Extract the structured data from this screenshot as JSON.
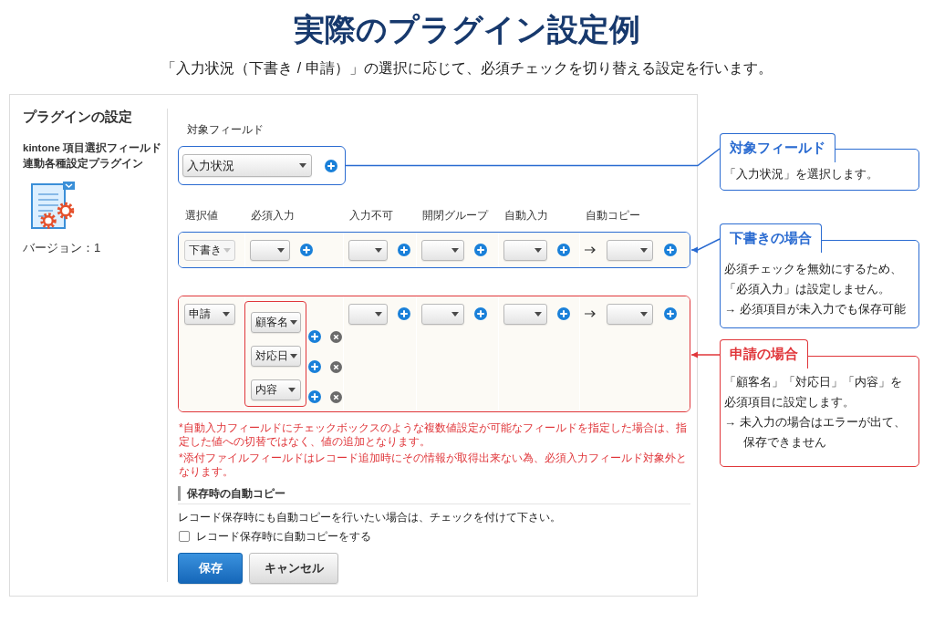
{
  "title": "実際のプラグイン設定例",
  "subtitle": "「入力状況（下書き / 申請）」の選択に応じて、必須チェックを切り替える設定を行います。",
  "plugin_settings": {
    "sidebar": {
      "heading": "プラグインの設定",
      "plugin_name": [
        "kintone 項目選択フィールド",
        "連動各種設定プラグイン"
      ],
      "version": "バージョン：1"
    },
    "target_field": {
      "label": "対象フィールド",
      "value": "入力状況"
    },
    "columns": [
      {
        "label": "選択値",
        "kind": "value"
      },
      {
        "label": "必須入力",
        "kind": "multi"
      },
      {
        "label": "入力不可",
        "kind": "single"
      },
      {
        "label": "開閉グループ",
        "kind": "single"
      },
      {
        "label": "自動入力",
        "kind": "single"
      },
      {
        "label": "自動コピー",
        "kind": "copy"
      }
    ],
    "rows": [
      {
        "color": "#2a6bd1",
        "value": "下書き",
        "value_disabled": true,
        "required_outlined": false,
        "required": [
          {
            "removable": false
          }
        ]
      },
      {
        "color": "#e0363a",
        "value": "申請",
        "value_disabled": false,
        "required_outlined": true,
        "required": [
          {
            "value": "顧客名",
            "removable": true
          },
          {
            "value": "対応日",
            "removable": true
          },
          {
            "value": "内容",
            "removable": true
          }
        ]
      }
    ],
    "notes": [
      "*自動入力フィールドにチェックボックスのような複数値設定が可能なフィールドを指定した場合は、指定した値への切替ではなく、値の追加となります。",
      "*添付ファイルフィールドはレコード追加時にその情報が取得出来ない為、必須入力フィールド対象外となります。"
    ],
    "auto_copy": {
      "heading": "保存時の自動コピー",
      "description": "レコード保存時にも自動コピーを行いたい場合は、チェックを付けて下さい。",
      "checkbox": {
        "label": "レコード保存時に自動コピーをする",
        "checked": false
      }
    },
    "buttons": [
      {
        "label": "保存",
        "kind": "primary"
      },
      {
        "label": "キャンセル",
        "kind": "secondary"
      }
    ]
  },
  "callouts": [
    {
      "title": "対象フィールド",
      "color": "#2a6bd1",
      "arrowhead": false,
      "paragraphs": [
        {
          "kind": "plain",
          "lines": [
            "「入力状況」を選択します。"
          ]
        }
      ]
    },
    {
      "title": "下書きの場合",
      "color": "#2a6bd1",
      "arrowhead": true,
      "paragraphs": [
        {
          "kind": "plain",
          "lines": [
            "必須チェックを無効にするため、",
            "「必須入力」は設定しません。"
          ]
        },
        {
          "kind": "arrow",
          "lines": [
            "→ 必須項目が未入力でも保存可能"
          ]
        }
      ]
    },
    {
      "title": "申請の場合",
      "color": "#e0363a",
      "arrowhead": true,
      "paragraphs": [
        {
          "kind": "plain",
          "lines": [
            "「顧客名」「対応日」「内容」を",
            "必須項目に設定します。"
          ]
        },
        {
          "kind": "arrow",
          "lines": [
            "→ 未入力の場合はエラーが出て、",
            "保存できません"
          ]
        }
      ]
    }
  ]
}
